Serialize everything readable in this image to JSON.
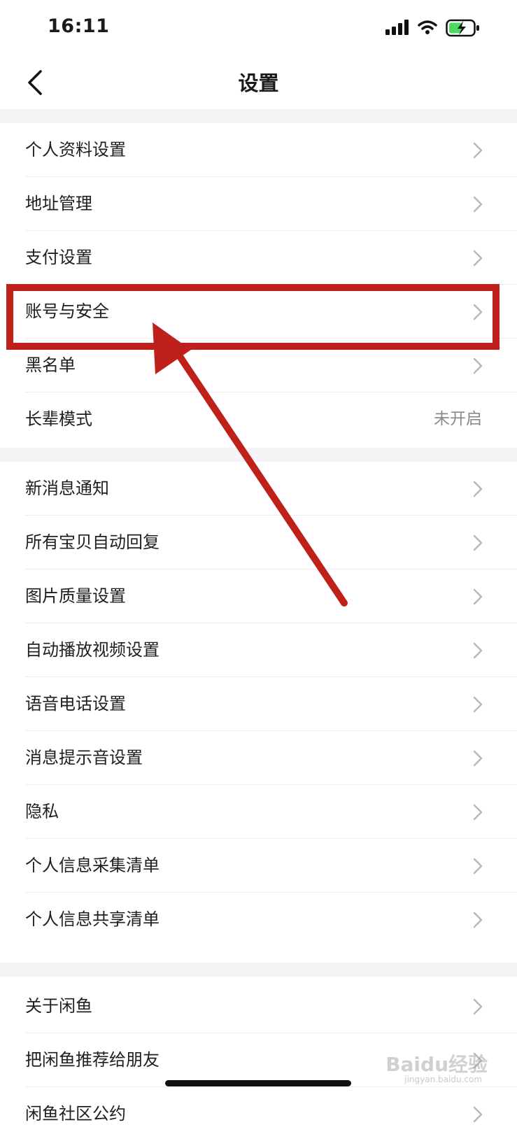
{
  "status_bar": {
    "time": "16:11"
  },
  "header": {
    "title": "设置"
  },
  "sections": [
    {
      "items": [
        {
          "label": "个人资料设置"
        },
        {
          "label": "地址管理"
        },
        {
          "label": "支付设置"
        },
        {
          "label": "账号与安全"
        },
        {
          "label": "黑名单"
        },
        {
          "label": "长辈模式",
          "value": "未开启"
        }
      ]
    },
    {
      "items": [
        {
          "label": "新消息通知"
        },
        {
          "label": "所有宝贝自动回复"
        },
        {
          "label": "图片质量设置"
        },
        {
          "label": "自动播放视频设置"
        },
        {
          "label": "语音电话设置"
        },
        {
          "label": "消息提示音设置"
        },
        {
          "label": "隐私"
        },
        {
          "label": "个人信息采集清单"
        },
        {
          "label": "个人信息共享清单"
        }
      ]
    },
    {
      "items": [
        {
          "label": "关于闲鱼"
        },
        {
          "label": "把闲鱼推荐给朋友"
        },
        {
          "label": "闲鱼社区公约"
        }
      ]
    }
  ],
  "annotation": {
    "color": "#c0201c",
    "highlighted_item": "账号与安全"
  },
  "watermark": {
    "text": "Baidu经验",
    "sub": "jingyan.baidu.com"
  }
}
